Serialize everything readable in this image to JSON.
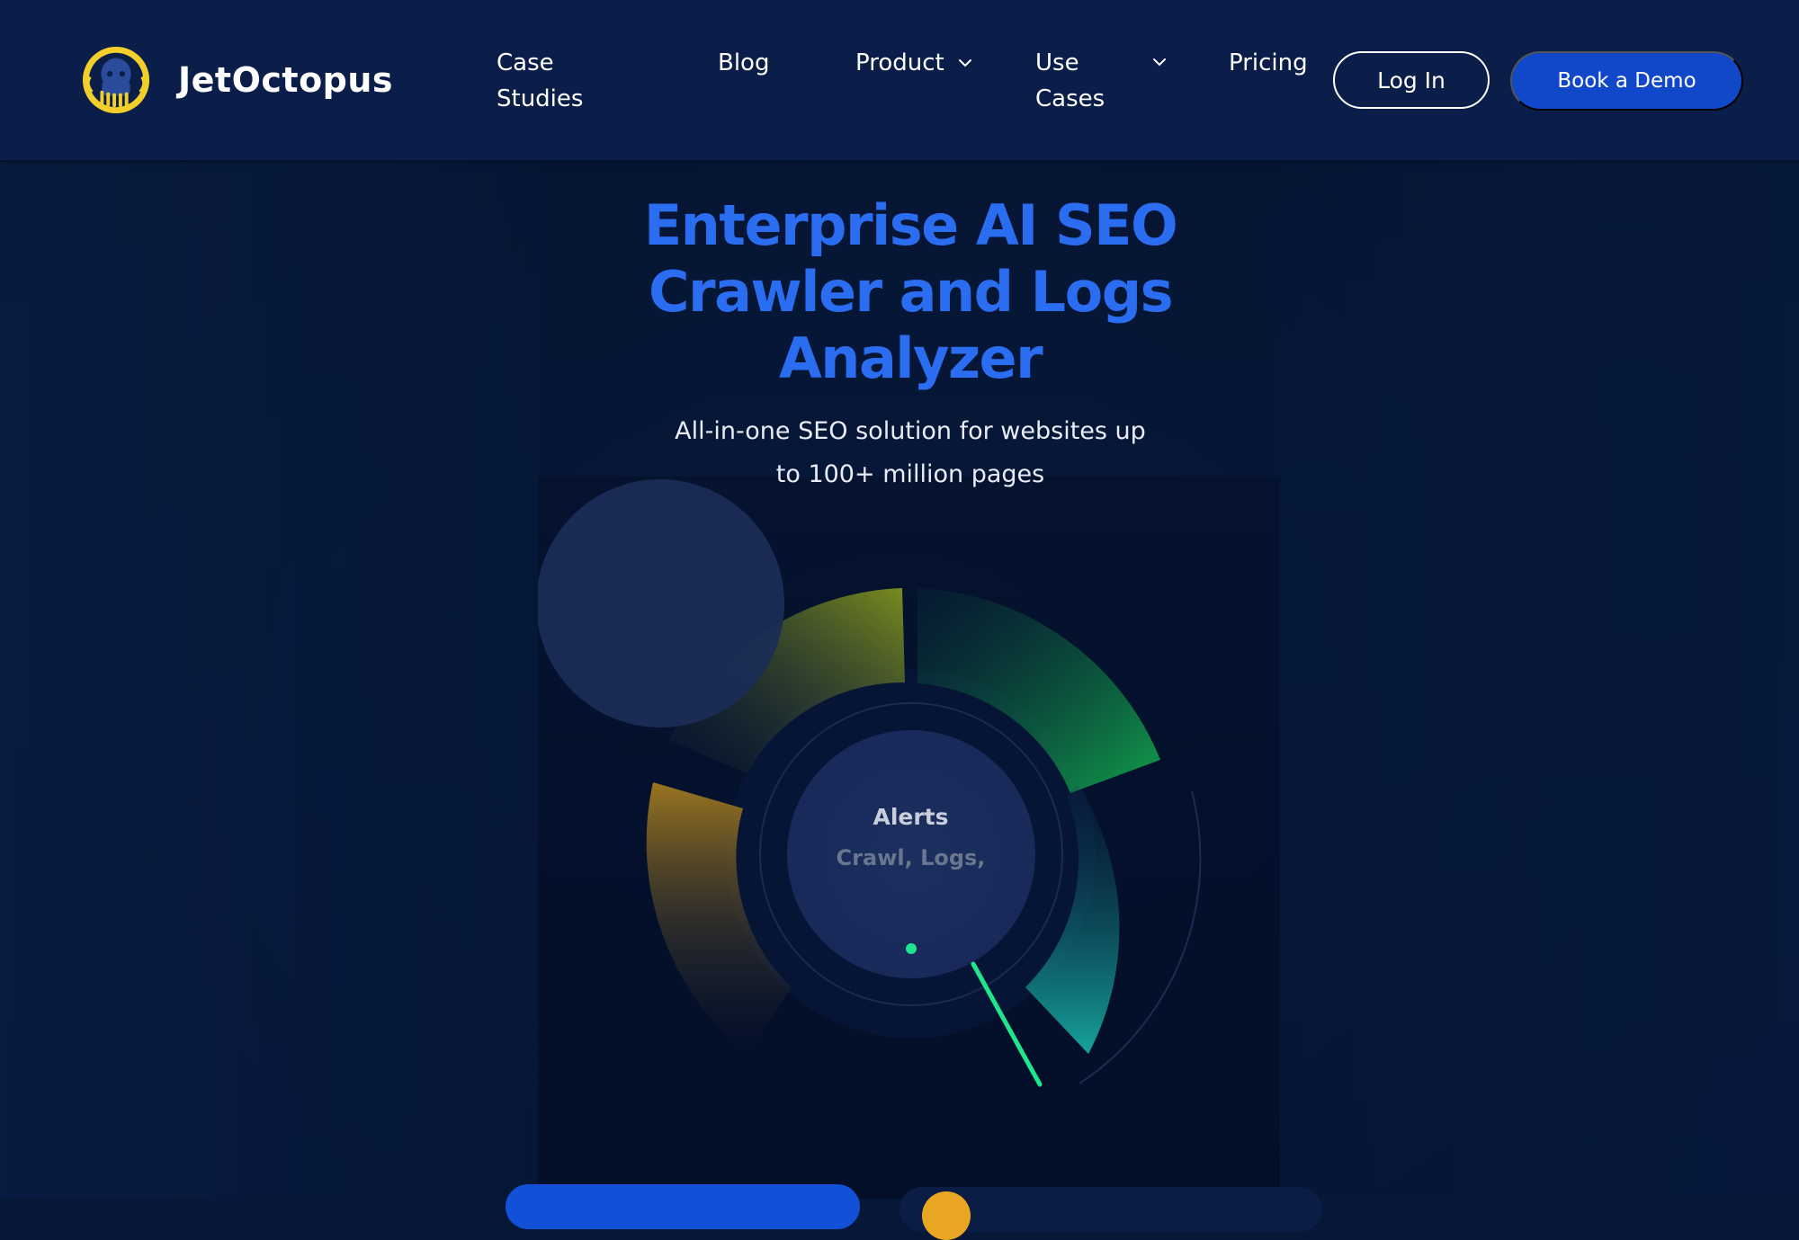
{
  "brand": {
    "name": "JetOctopus",
    "logo_icon": "octopus-logo-icon",
    "logo_colors": {
      "ring": "#f2cf2a",
      "body": "#2b4b9b"
    }
  },
  "nav": {
    "case_studies": "Case Studies",
    "blog": "Blog",
    "product": "Product",
    "use_cases": "Use Cases",
    "pricing": "Pricing",
    "chevron_icon": "chevron-down-icon"
  },
  "header_actions": {
    "login": "Log In",
    "book_demo": "Book a Demo"
  },
  "hero": {
    "title": "Enterprise AI SEO Crawler and Logs Analyzer",
    "subtitle": "All-in-one SEO solution for websites up to 100+ million pages"
  },
  "dashboard_visual": {
    "center_title": "Alerts",
    "center_subtitle": "Crawl, Logs,"
  },
  "colors": {
    "background": "#061738",
    "header": "#0b1e4a",
    "accent_blue": "#2b6df0",
    "button_blue": "#1048c9",
    "green_segment": "#11a04b",
    "teal_segment": "#14a59b",
    "olive_segment": "#7a8c1e",
    "amber_segment": "#9a7520",
    "needle": "#1ee68c"
  }
}
